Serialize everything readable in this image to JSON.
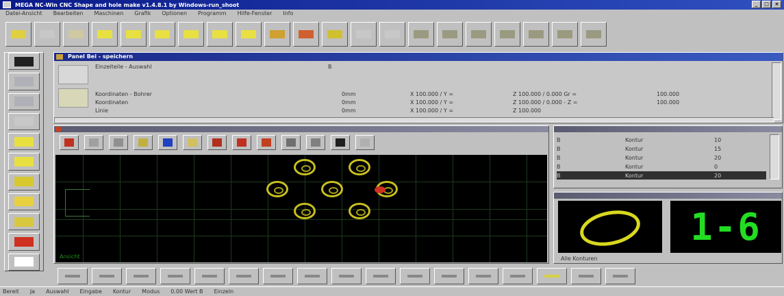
{
  "window": {
    "title": "MEGA NC-Win CNC Shape and hole make v1.4.8.1 by Windows-run_shoot",
    "buttons": [
      "_",
      "□",
      "×"
    ]
  },
  "menu": [
    "Datei-Ansicht",
    "Bearbeiten",
    "Maschinen",
    "Grafik",
    "Optionen",
    "Programm",
    "Hilfe-Fenster",
    "Info"
  ],
  "toolbar": {
    "buttons": [
      {
        "name": "exit",
        "color": "#e0d040"
      },
      {
        "name": "new",
        "color": "#c8c8c8"
      },
      {
        "name": "open",
        "color": "#d0c8a0"
      },
      {
        "name": "draw-rect",
        "color": "#e8e040"
      },
      {
        "name": "draw-shape",
        "color": "#e8e040"
      },
      {
        "name": "draw-polygon",
        "color": "#e8e040"
      },
      {
        "name": "draw-poly2",
        "color": "#e8e040"
      },
      {
        "name": "draw-arc",
        "color": "#e8e040"
      },
      {
        "name": "draw-box",
        "color": "#e8e040"
      },
      {
        "name": "line-h",
        "color": "#d0a030"
      },
      {
        "name": "line-red",
        "color": "#d06030"
      },
      {
        "name": "line-yellow",
        "color": "#d0c030"
      },
      {
        "name": "empty-1",
        "color": "#c8c8c8"
      },
      {
        "name": "empty-2",
        "color": "#c8c8c8"
      },
      {
        "name": "ops-1",
        "color": "#9a9a80"
      },
      {
        "name": "ops-2",
        "color": "#9a9a80"
      },
      {
        "name": "ops-3",
        "color": "#9a9a80"
      },
      {
        "name": "ops-4",
        "color": "#9a9a80"
      },
      {
        "name": "ops-5",
        "color": "#9a9a80"
      },
      {
        "name": "ops-6",
        "color": "#9a9a80"
      },
      {
        "name": "ops-7",
        "color": "#9a9a80"
      }
    ]
  },
  "left_tools": [
    "lock",
    "cut-1",
    "cut-2",
    "rect",
    "yellow-1",
    "rect-2",
    "yellow-2",
    "yellow-3",
    "tool-4",
    "red-tool",
    "page"
  ],
  "panel_main": {
    "title": "Panel Bei - speichern",
    "row0": {
      "label": "Einzelteile - Auswahl",
      "value": "B"
    },
    "rows": [
      {
        "label": "Koordinaten - Bohrer",
        "c2": "0mm",
        "c3": "X 100.000 / Y =",
        "c4": "Z 100.000 / 0.000 Gr =",
        "c5": "100.000"
      },
      {
        "label": "Koordinaten",
        "c2": "0mm",
        "c3": "X 100.000 / Y =",
        "c4": "Z 100.000 / 0.000 - Z =",
        "c5": "100.000"
      },
      {
        "label": "Linie",
        "c2": "0mm",
        "c3": "X 100.000 / Y =",
        "c4": "Z 100.000",
        "c5": ""
      }
    ]
  },
  "graph_panel": {
    "tools": [
      "red-tool",
      "zoom",
      "rect-tool",
      "pencil",
      "blue-marker",
      "frame",
      "chart",
      "red-cut",
      "red-cut-2",
      "corner",
      "box",
      "close",
      "empty"
    ],
    "status_label": "Ansicht"
  },
  "holes": [
    {
      "col": 2,
      "row": 0
    },
    {
      "col": 4,
      "row": 0
    },
    {
      "col": 1,
      "row": 1
    },
    {
      "col": 3,
      "row": 1
    },
    {
      "col": 5,
      "row": 1
    },
    {
      "col": 2,
      "row": 2
    },
    {
      "col": 4,
      "row": 2
    }
  ],
  "list_panel": {
    "rows": [
      {
        "c1": "B",
        "c2": "",
        "c3": "Kontur",
        "c4": "10"
      },
      {
        "c1": "B",
        "c2": "",
        "c3": "Kontur",
        "c4": "15"
      },
      {
        "c1": "B",
        "c2": "",
        "c3": "Kontur",
        "c4": "20"
      },
      {
        "c1": "B",
        "c2": "",
        "c3": "Kontur",
        "c4": "0"
      },
      {
        "c1": "B",
        "c2": "",
        "c3": "Kontur",
        "c4": "20"
      }
    ]
  },
  "display_panel": {
    "tool_number": "1-6",
    "label": "Alle Konturen"
  },
  "bottom_buttons": [
    "sheet",
    "dots",
    "btn-3",
    "btn-4",
    "btn-5",
    "btn-6",
    "btn-7",
    "btn-8",
    "btn-9",
    "btn-10",
    "btn-11",
    "btn-12",
    "btn-13",
    "btn-14",
    "btn-15",
    "btn-16",
    "btn-17"
  ],
  "status": [
    "Bereit",
    "Ja",
    "Auswahl",
    "Eingabe",
    "Kontur",
    "Modus",
    "0.00 Wert B",
    "Einzeln"
  ],
  "colors": {
    "accent": "#1a2a8a",
    "hole": "#c8c020",
    "selected": "#d03020",
    "readout": "#22dd22"
  }
}
